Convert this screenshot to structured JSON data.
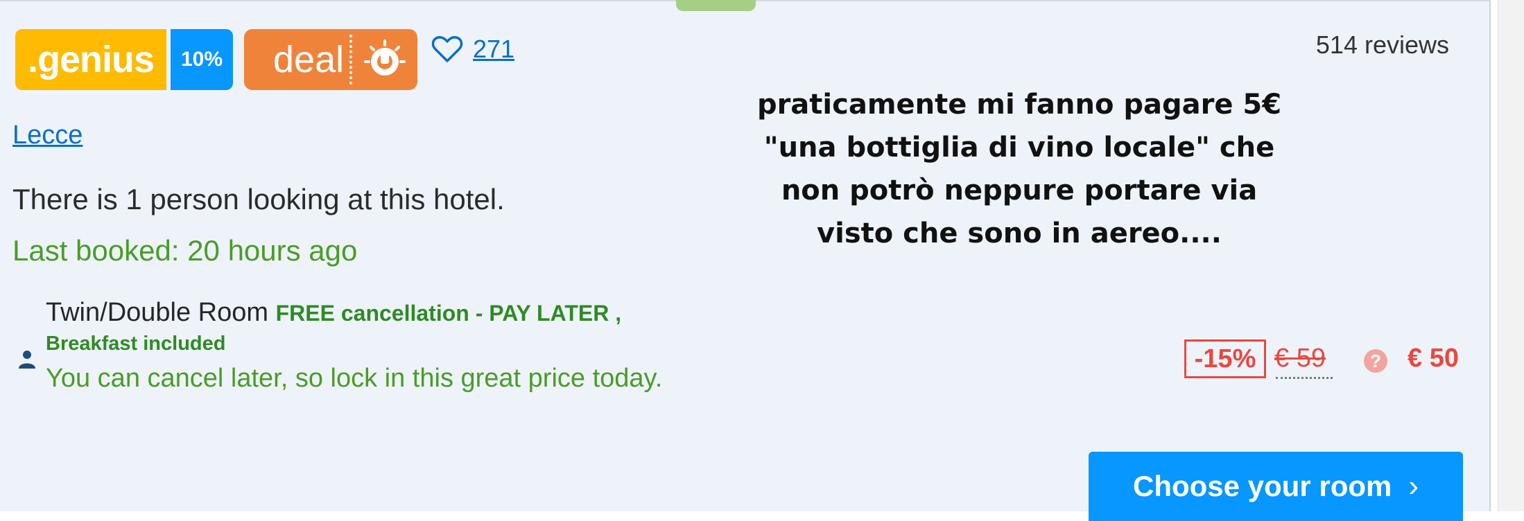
{
  "listing": {
    "badges": {
      "genius": ".genius",
      "genius_percent": "10%",
      "deal": "deal"
    },
    "wishlist_count": "271",
    "reviews": "514 reviews",
    "location": "Lecce",
    "viewers_text": "There is 1 person looking at this hotel.",
    "last_booked": "Last booked: 20 hours ago",
    "room": {
      "name": "Twin/Double Room",
      "conditions": "FREE cancellation - PAY LATER ,",
      "breakfast": "Breakfast included",
      "cancel_note": "You can cancel later, so lock in this great price today."
    },
    "pricing": {
      "discount": "-15%",
      "old_price": "€ 59",
      "help_icon": "?",
      "new_price": "€ 50"
    },
    "cta": {
      "label": "Choose your room",
      "chevron": "›"
    }
  },
  "overlay_caption": {
    "lines": [
      "praticamente mi fanno pagare 5€",
      "\"una bottiglia di vino locale\" che",
      "non potrò neppure portare via",
      "visto che sono in aereo...."
    ]
  },
  "colors": {
    "genius_yellow": "#febb02",
    "genius_blue": "#0896ff",
    "deal_orange": "#f0833a",
    "link_blue": "#0b6fc5",
    "success_green": "#4a9c27",
    "price_red": "#e8483f",
    "cta_blue": "#0896ff"
  },
  "icons": [
    "heart-icon",
    "deal-bulb-icon",
    "person-icon",
    "help-icon",
    "chevron-right-icon"
  ]
}
